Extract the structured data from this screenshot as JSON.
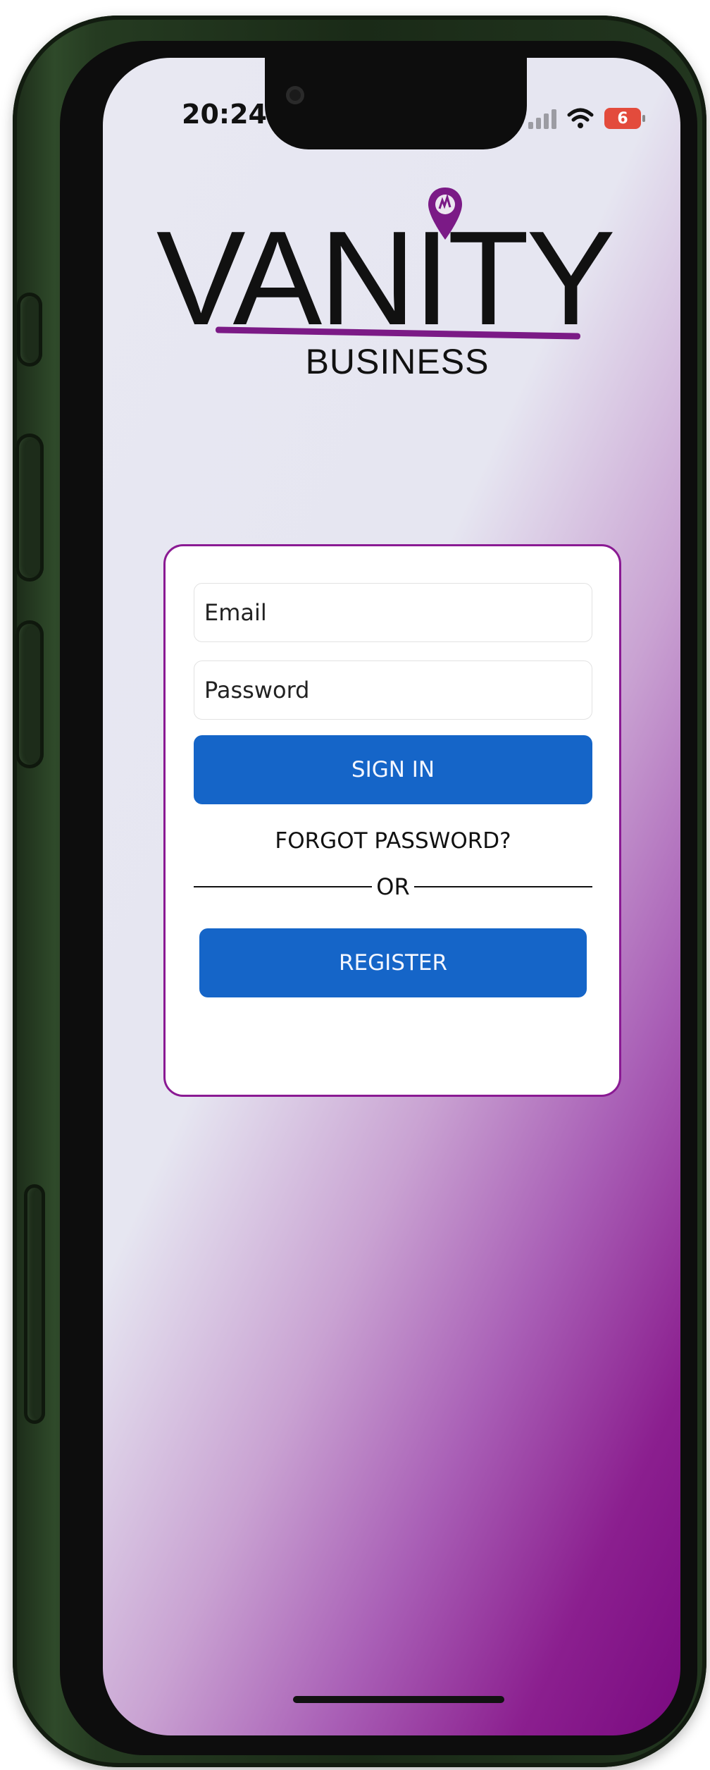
{
  "status_bar": {
    "time": "20:24",
    "battery_level": "6",
    "icons": [
      "signal-icon",
      "wifi-icon",
      "battery-icon"
    ]
  },
  "logo": {
    "brand": "VANITY",
    "subtitle": "BUSINESS",
    "icon": "location-pin-icon"
  },
  "login_form": {
    "email_placeholder": "Email",
    "password_placeholder": "Password",
    "sign_in_label": "SIGN IN",
    "forgot_password_label": "FORGOT PASSWORD?",
    "divider_text": "OR",
    "register_label": "REGISTER"
  },
  "colors": {
    "accent_purple": "#8a1a93",
    "button_blue": "#1565c8",
    "phone_frame_green": "#2f4a2a"
  }
}
